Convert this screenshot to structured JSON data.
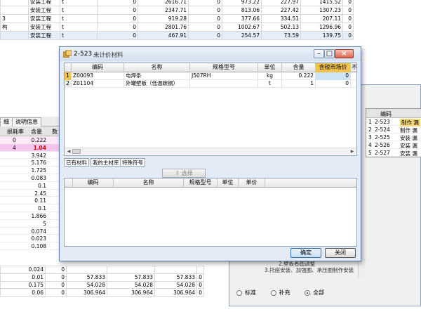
{
  "top_rows": [
    {
      "label": "",
      "type": "安装工程",
      "unit": "t",
      "v1": "0",
      "v2": "2616.71",
      "v3": "0",
      "v4": "973.22",
      "v5": "227.97",
      "v6": "1415.52",
      "v7": "0"
    },
    {
      "label": "",
      "type": "安装工程",
      "unit": "t",
      "v1": "0",
      "v2": "2347.71",
      "v3": "0",
      "v4": "813.06",
      "v5": "227.42",
      "v6": "1307.23",
      "v7": "0"
    },
    {
      "label": "3",
      "type": "安装工程",
      "unit": "t",
      "v1": "0",
      "v2": "919.28",
      "v3": "0",
      "v4": "377.66",
      "v5": "334.51",
      "v6": "207.11",
      "v7": "0"
    },
    {
      "label": "构",
      "type": "安装工程",
      "unit": "t",
      "v1": "0",
      "v2": "2801.76",
      "v3": "0",
      "v4": "1002.67",
      "v5": "502.13",
      "v6": "1296.96",
      "v7": "0"
    },
    {
      "label": "",
      "type": "安装工程",
      "unit": "t",
      "v1": "0",
      "v2": "467.91",
      "v3": "0",
      "v4": "254.57",
      "v5": "73.59",
      "v6": "139.75",
      "v7": "0"
    }
  ],
  "left_panel": {
    "tabs": [
      "细",
      "说明信息"
    ],
    "headers": [
      "损耗率",
      "含量",
      "数"
    ],
    "rows": [
      {
        "loss": "0",
        "qty": "0.222"
      },
      {
        "loss": "4",
        "qty": "1.04"
      },
      {
        "loss": "",
        "qty": "3.942"
      },
      {
        "loss": "",
        "qty": "5.176"
      },
      {
        "loss": "",
        "qty": "1.725"
      },
      {
        "loss": "",
        "qty": "0.083"
      },
      {
        "loss": "",
        "qty": "0.1"
      },
      {
        "loss": "",
        "qty": "2.45"
      },
      {
        "loss": "",
        "qty": "0.11"
      },
      {
        "loss": "",
        "qty": "0.1"
      },
      {
        "loss": "",
        "qty": "1.866"
      },
      {
        "loss": "",
        "qty": "5"
      },
      {
        "loss": "",
        "qty": "0.074"
      },
      {
        "loss": "",
        "qty": "0.023"
      },
      {
        "loss": "",
        "qty": "0.108"
      }
    ]
  },
  "bottom_rows": [
    [
      "0.024",
      "0",
      "",
      "",
      "",
      ""
    ],
    [
      "0.01",
      "0",
      "57.833",
      "57.833",
      "57.833",
      "0"
    ],
    [
      "0.175",
      "0",
      "54.028",
      "54.028",
      "54.028",
      "0"
    ],
    [
      "0.06",
      "0",
      "306.964",
      "306.964",
      "306.964",
      "0"
    ]
  ],
  "right_window": {
    "headers": [
      "编码"
    ],
    "rows": [
      {
        "num": "1",
        "code": "2-523",
        "desc": "制作 漏",
        "selected": true
      },
      {
        "num": "2",
        "code": "2-524",
        "desc": "制作 漏",
        "selected": false
      },
      {
        "num": "3",
        "code": "2-525",
        "desc": "安装 漏",
        "selected": false
      },
      {
        "num": "4",
        "code": "2-526",
        "desc": "安装 漏",
        "selected": false
      },
      {
        "num": "5",
        "code": "2-527",
        "desc": "安装 漏",
        "selected": false
      }
    ],
    "tree": [
      "2.壁板卷圆调整",
      "3.托座安装、加强圈、承压圈制作安装"
    ],
    "radios": [
      {
        "label": "标准",
        "checked": false
      },
      {
        "label": "补充",
        "checked": false
      },
      {
        "label": "全部",
        "checked": true
      }
    ]
  },
  "dialog": {
    "title_code": "2-523",
    "title_text": "未计价材料",
    "upper_headers": [
      "",
      "编码",
      "名称",
      "规格型号",
      "单位",
      "含量",
      "含税市场价",
      "不含"
    ],
    "upper_rows": [
      {
        "num": "1",
        "code": "Z00093",
        "name": "电焊条",
        "spec": "J507RH",
        "unit": "kg",
        "qty": "0.222",
        "price": "0"
      },
      {
        "num": "2",
        "code": "Z01104",
        "name": "外罐壁板（低温碳钢）",
        "spec": "",
        "unit": "t",
        "qty": "1",
        "price": "0"
      }
    ],
    "tabs": [
      "已有材料",
      "我的主材库",
      "特殊符号"
    ],
    "select_button": "选择",
    "lower_headers": [
      "",
      "编码",
      "名称",
      "规格型号",
      "单位",
      "单价"
    ],
    "ok_button": "确定",
    "close_button": "关闭"
  },
  "colors": {
    "title_bar": "#d3e0ee",
    "highlight_header": "#f3c34e",
    "selected_cell": "#cde4f7",
    "pink_row": "#f7c6ee",
    "red_value": "#d00000"
  }
}
